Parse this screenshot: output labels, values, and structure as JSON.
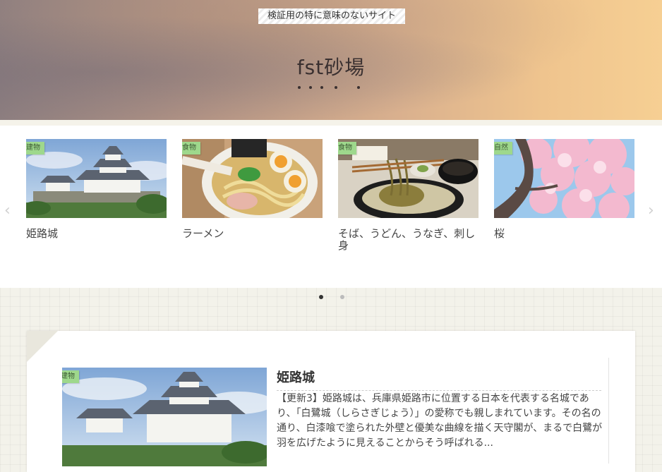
{
  "header": {
    "tagline": "検証用の特に意味のないサイト",
    "site_title": "fst砂場"
  },
  "carousel": {
    "items": [
      {
        "category": "建物",
        "title": "姫路城",
        "image": "himeji-castle"
      },
      {
        "category": "食物",
        "title": "ラーメン",
        "image": "ramen"
      },
      {
        "category": "食物",
        "title": "そば、うどん、うなぎ、刺し身",
        "image": "soba"
      },
      {
        "category": "自然",
        "title": "桜",
        "image": "cherry-blossom"
      }
    ],
    "prev_arrow": "‹",
    "next_arrow": "›",
    "pages": 2,
    "active_page": 1
  },
  "article": {
    "category": "建物",
    "title": "姫路城",
    "excerpt": "【更新3】姫路城は、兵庫県姫路市に位置する日本を代表する名城であり、「白鷺城（しらさぎじょう）」の愛称でも親しまれています。その名の通り、白漆喰で塗られた外壁と優美な曲線を描く天守閣が、まるで白鷺が羽を広げたように見えることからそう呼ばれる..."
  },
  "colors": {
    "category_label": "#9ed88c",
    "pager_active": "#333333",
    "pager_inactive": "#bbbbbb"
  }
}
